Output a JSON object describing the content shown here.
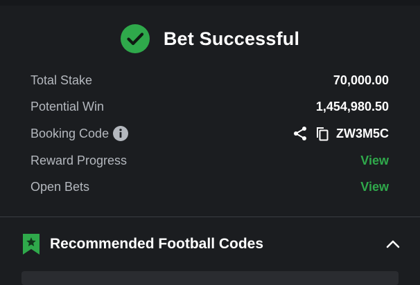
{
  "bet": {
    "title": "Bet Successful",
    "rows": [
      {
        "label": "Total Stake",
        "value": "70,000.00"
      },
      {
        "label": "Potential Win",
        "value": "1,454,980.50"
      },
      {
        "label": "Booking Code",
        "value": "ZW3M5C"
      },
      {
        "label": "Reward Progress",
        "value": "View"
      },
      {
        "label": "Open Bets",
        "value": "View"
      }
    ]
  },
  "recommended": {
    "title": "Recommended Football Codes",
    "first_card": {
      "code": "",
      "mid": "",
      "right": ""
    }
  },
  "colors": {
    "background": "#1b1d20",
    "accent_green": "#2fa94b",
    "label_gray": "#b4b8be"
  },
  "icons": {
    "success": "check-circle-icon",
    "info": "info-icon",
    "share": "share-icon",
    "copy": "copy-icon",
    "bookmark": "bookmark-star-icon",
    "collapse": "chevron-up-icon"
  }
}
